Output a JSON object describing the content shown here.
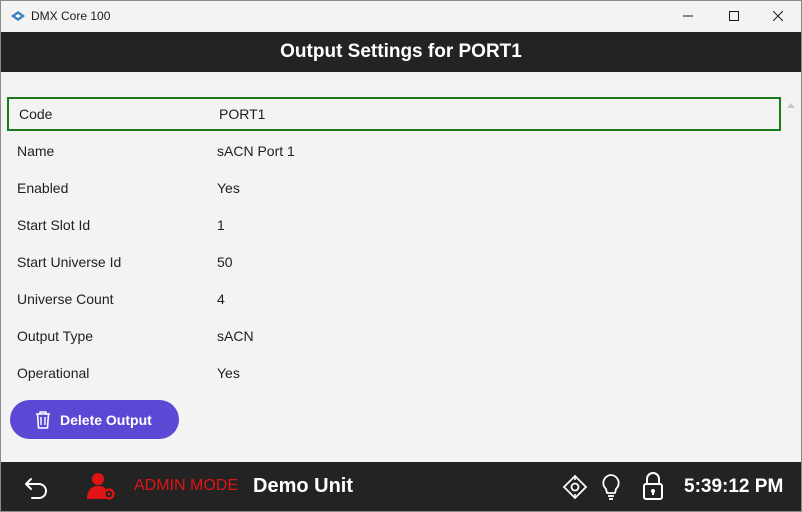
{
  "window": {
    "title": "DMX Core 100"
  },
  "header": {
    "title": "Output Settings for PORT1"
  },
  "fields": [
    {
      "label": "Code",
      "value": "PORT1"
    },
    {
      "label": "Name",
      "value": "sACN Port 1"
    },
    {
      "label": "Enabled",
      "value": "Yes"
    },
    {
      "label": "Start Slot Id",
      "value": "1"
    },
    {
      "label": "Start Universe Id",
      "value": "50"
    },
    {
      "label": "Universe Count",
      "value": "4"
    },
    {
      "label": "Output Type",
      "value": "sACN"
    },
    {
      "label": "Operational",
      "value": "Yes"
    }
  ],
  "actions": {
    "delete_label": "Delete Output"
  },
  "statusbar": {
    "mode": "ADMIN MODE",
    "unit": "Demo Unit",
    "time": "5:39:12 PM"
  },
  "colors": {
    "accent": "#5b48d4",
    "bar": "#232323",
    "admin": "#e01414",
    "selection": "#1a7a1a"
  },
  "icons": [
    "app-logo-icon",
    "minimize-icon",
    "maximize-icon",
    "close-icon",
    "trash-icon",
    "back-icon",
    "admin-user-icon",
    "locate-icon",
    "lightbulb-icon",
    "lock-icon",
    "scroll-up-icon"
  ]
}
